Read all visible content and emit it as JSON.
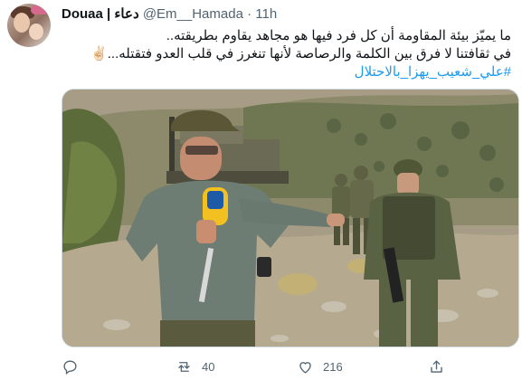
{
  "author": {
    "name": "Douaa | دعاء",
    "handle": "@Em__Hamada",
    "separator": "·",
    "time": "11h"
  },
  "tweet": {
    "line1": "ما يميّز بيئة المقاومة أن كل فرد فيها هو مجاهد يقاوم بطريقته..",
    "line2": "في ثقافتنا لا فرق بين الكلمة والرصاصة لأنها تنغرز في قلب العدو فتقتله...✌🏻",
    "hashtag": "#علي_شعيب_يهزا_بالاحتلال"
  },
  "media": {
    "alt_icons": [
      "microphone-with-channel-logo"
    ]
  },
  "actions": {
    "reply_count": "",
    "retweet_count": "40",
    "like_count": "216",
    "share_count": ""
  },
  "colors": {
    "link": "#1d9bf0",
    "muted": "#536471",
    "text": "#0f1419"
  }
}
